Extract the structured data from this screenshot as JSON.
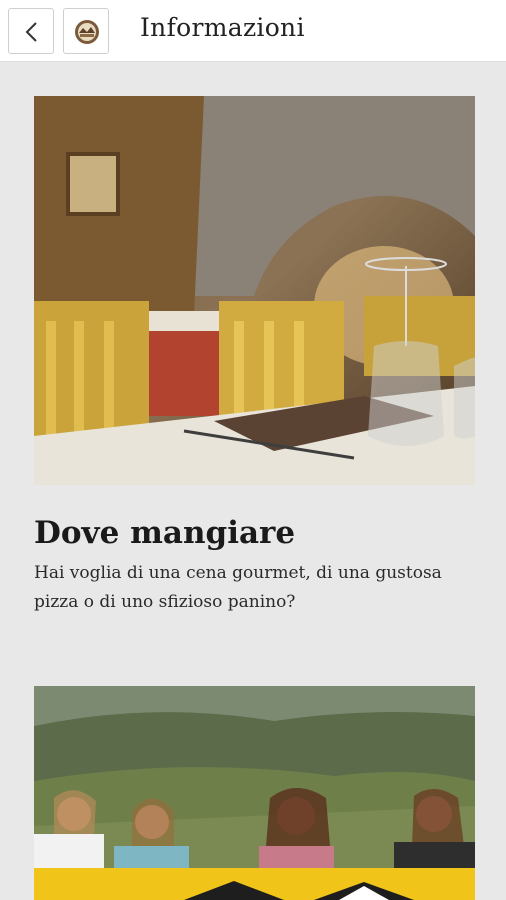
{
  "header": {
    "title": "Informazioni",
    "back_icon": "chevron-left-icon",
    "logo_icon": "app-logo-icon"
  },
  "cards": [
    {
      "title": "Dove mangiare",
      "description": "Hai voglia di una cena gourmet, di una gustosa pizza o di uno sfizioso panino?",
      "image": "restaurant-interior-photo"
    },
    {
      "title": "",
      "description": "",
      "image": "group-of-women-mountain-photo"
    }
  ],
  "colors": {
    "background": "#e8e8e8",
    "appbar": "#ffffff",
    "text": "#1a1a1a"
  }
}
